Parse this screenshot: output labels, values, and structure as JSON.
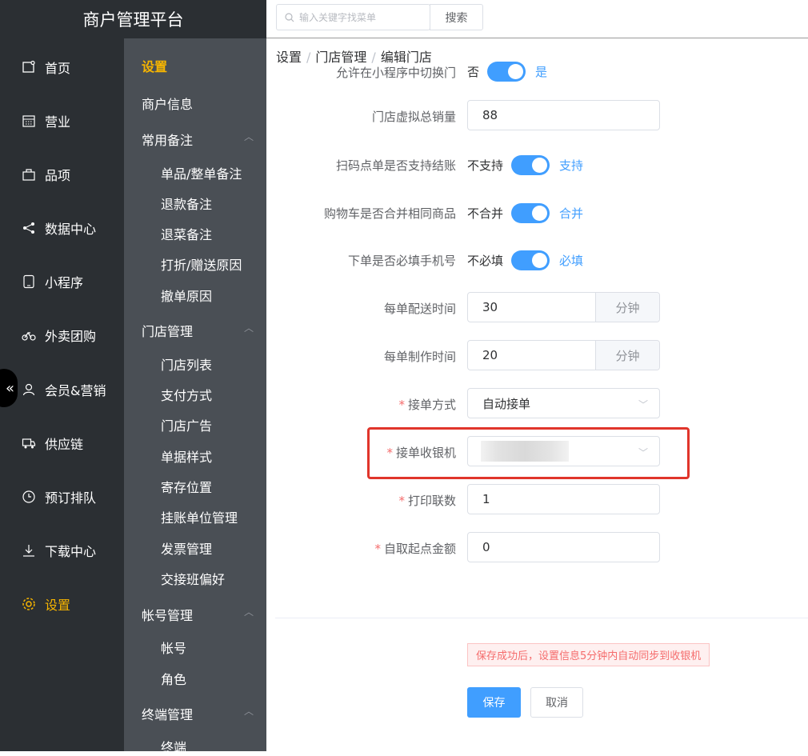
{
  "app": {
    "title": "商户管理平台"
  },
  "search": {
    "placeholder": "输入关键字找菜单",
    "button": "搜索"
  },
  "sidebar": {
    "items": [
      {
        "label": "首页",
        "icon": "home-icon"
      },
      {
        "label": "营业",
        "icon": "calendar-icon"
      },
      {
        "label": "品项",
        "icon": "bag-icon"
      },
      {
        "label": "数据中心",
        "icon": "share-icon"
      },
      {
        "label": "小程序",
        "icon": "phone-icon"
      },
      {
        "label": "外卖团购",
        "icon": "bike-icon"
      },
      {
        "label": "会员&营销",
        "icon": "user-icon"
      },
      {
        "label": "供应链",
        "icon": "truck-icon"
      },
      {
        "label": "预订排队",
        "icon": "clock-icon"
      },
      {
        "label": "下载中心",
        "icon": "download-icon"
      },
      {
        "label": "设置",
        "icon": "gear-icon"
      }
    ],
    "collapse_icon": "«"
  },
  "subnav": {
    "title": "设置",
    "merchant_info": "商户信息",
    "groups": [
      {
        "label": "常用备注",
        "items": [
          "单品/整单备注",
          "退款备注",
          "退菜备注",
          "打折/赠送原因",
          "撤单原因"
        ]
      },
      {
        "label": "门店管理",
        "items": [
          "门店列表",
          "支付方式",
          "门店广告",
          "单据样式",
          "寄存位置",
          "挂账单位管理",
          "发票管理",
          "交接班偏好"
        ]
      },
      {
        "label": "帐号管理",
        "items": [
          "帐号",
          "角色"
        ]
      },
      {
        "label": "终端管理",
        "items": [
          "终端"
        ]
      }
    ]
  },
  "breadcrumb": [
    "设置",
    "门店管理",
    "编辑门店"
  ],
  "form": {
    "partial_row": {
      "label": "允许在小程序中切换门",
      "off": "否",
      "on": "是"
    },
    "virtual_sales": {
      "label": "门店虚拟总销量",
      "value": "88"
    },
    "scan_checkout": {
      "label": "扫码点单是否支持结账",
      "off": "不支持",
      "on": "支持"
    },
    "merge_cart": {
      "label": "购物车是否合并相同商品",
      "off": "不合并",
      "on": "合并"
    },
    "require_phone": {
      "label": "下单是否必填手机号",
      "off": "不必填",
      "on": "必填"
    },
    "delivery_time": {
      "label": "每单配送时间",
      "value": "30",
      "unit": "分钟"
    },
    "prepare_time": {
      "label": "每单制作时间",
      "value": "20",
      "unit": "分钟"
    },
    "accept_mode": {
      "label": "接单方式",
      "value": "自动接单"
    },
    "cashier": {
      "label": "接单收银机"
    },
    "print_copies": {
      "label": "打印联数",
      "value": "1"
    },
    "pickup_min": {
      "label": "自取起点金额",
      "value": "0"
    },
    "required_mark": "*"
  },
  "notice": "保存成功后，设置信息5分钟内自动同步到收银机",
  "actions": {
    "save": "保存",
    "cancel": "取消"
  },
  "colors": {
    "accent": "#409eff",
    "active_nav": "#f7b500",
    "required": "#f56c6c",
    "sidebar_bg": "#2b2f33",
    "subnav_bg": "#4a4f55"
  }
}
